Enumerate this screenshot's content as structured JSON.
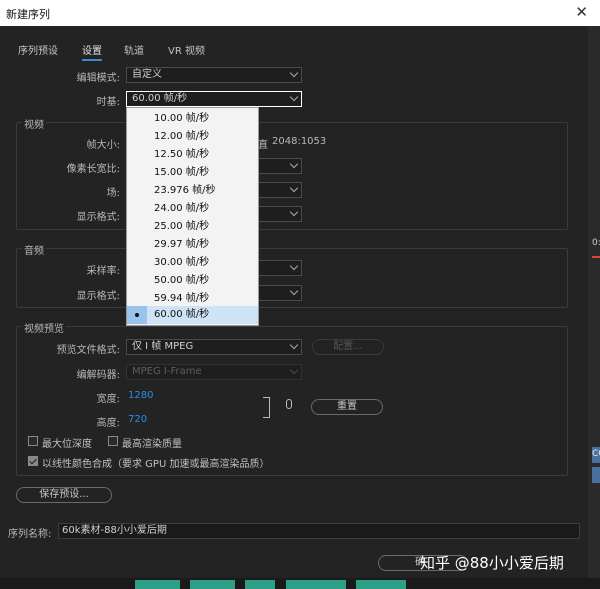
{
  "window": {
    "title": "新建序列",
    "close_glyph": "✕"
  },
  "tabs": [
    "序列预设",
    "设置",
    "轨道",
    "VR 视频"
  ],
  "settings": {
    "edit_mode": {
      "label": "编辑模式:",
      "value": "自定义"
    },
    "timebase": {
      "label": "时基:",
      "value": "60.00  帧/秒"
    }
  },
  "video": {
    "section": "视频",
    "frame_size_label": "帧大小:",
    "frame_size_tail": "直",
    "frame_size_ratio": "2048:1053",
    "pixel_aspect_label": "像素长宽比:",
    "fields_label": "场:",
    "display_format_label": "显示格式:"
  },
  "audio": {
    "section": "音频",
    "sample_rate_label": "采样率:",
    "display_format_label": "显示格式:"
  },
  "preview": {
    "section": "视频预览",
    "file_format_label": "预览文件格式:",
    "file_format_value": "仅 I 帧 MPEG",
    "configure_button": "配置...",
    "codec_label": "编解码器:",
    "codec_value": "MPEG I-Frame",
    "width_label": "宽度:",
    "width_value": "1280",
    "height_label": "高度:",
    "height_value": "720",
    "reset_button": "重置"
  },
  "checkboxes": {
    "max_bit_depth": {
      "label": "最大位深度",
      "checked": false
    },
    "max_render_quality": {
      "label": "最高渲染质量",
      "checked": false
    },
    "linear_color": {
      "label": "以线性颜色合成（要求 GPU 加速或最高渲染品质）",
      "checked": true
    }
  },
  "save_preset_button": "保存预设...",
  "sequence_name": {
    "label": "序列名称:",
    "value": "60k素材-88小小爱后期"
  },
  "timebase_options": [
    "10.00  帧/秒",
    "12.00  帧/秒",
    "12.50  帧/秒",
    "15.00  帧/秒",
    "23.976  帧/秒",
    "24.00  帧/秒",
    "25.00  帧/秒",
    "29.97  帧/秒",
    "30.00  帧/秒",
    "50.00  帧/秒",
    "59.94  帧/秒",
    "60.00  帧/秒"
  ],
  "selected_timebase_index": 11,
  "ok_button_partial": "确",
  "watermark": "知乎 @88小小爱后期",
  "right_edge": {
    "label_top": "0:",
    "label_mid": "CC"
  },
  "colors": {
    "accent": "#2d8ceb",
    "dropdown_selected": "#99c3ec",
    "timeline_bar": "#2e9f87"
  }
}
